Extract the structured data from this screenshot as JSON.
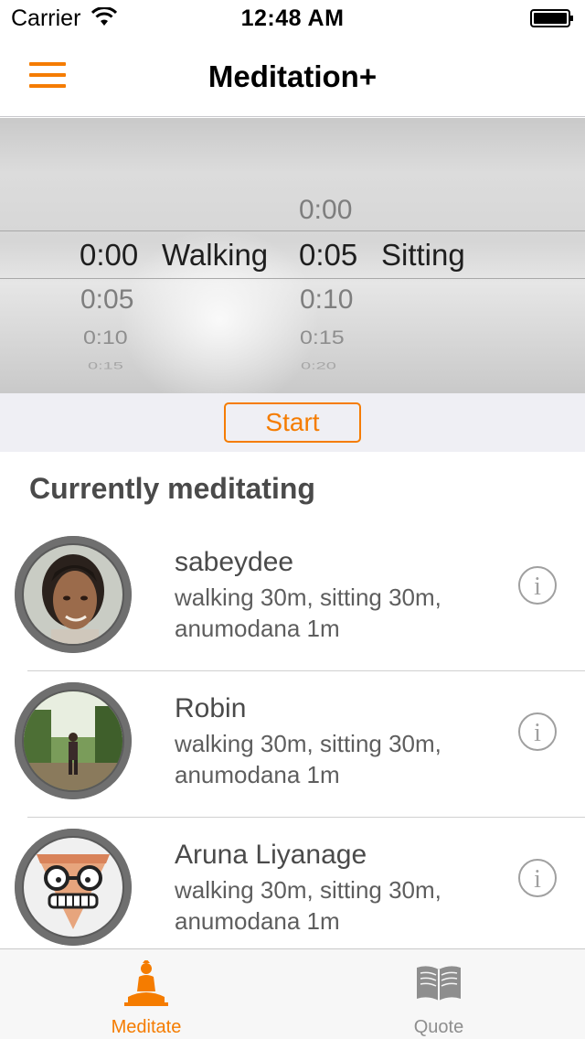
{
  "status_bar": {
    "carrier": "Carrier",
    "time": "12:48 AM"
  },
  "nav": {
    "title": "Meditation+"
  },
  "picker": {
    "walking": {
      "selected": "0:00",
      "label": "Walking",
      "below": [
        "0:05",
        "0:10",
        "0:15"
      ]
    },
    "sitting": {
      "selected": "0:05",
      "label": "Sitting",
      "above": "0:00",
      "below": [
        "0:10",
        "0:15",
        "0:20"
      ]
    }
  },
  "start_label": "Start",
  "section_title": "Currently meditating",
  "users": [
    {
      "name": "sabeydee",
      "detail": "walking 30m, sitting 30m, anumodana 1m"
    },
    {
      "name": "Robin",
      "detail": "walking 30m, sitting 30m, anumodana 1m"
    },
    {
      "name": "Aruna Liyanage",
      "detail": "walking 30m, sitting 30m, anumodana 1m"
    }
  ],
  "tabs": [
    {
      "label": "Meditate",
      "icon": "buddha-icon",
      "active": true
    },
    {
      "label": "Quote",
      "icon": "book-icon",
      "active": false
    }
  ],
  "colors": {
    "accent": "#f57c00",
    "inactive": "#8e8e8e"
  }
}
